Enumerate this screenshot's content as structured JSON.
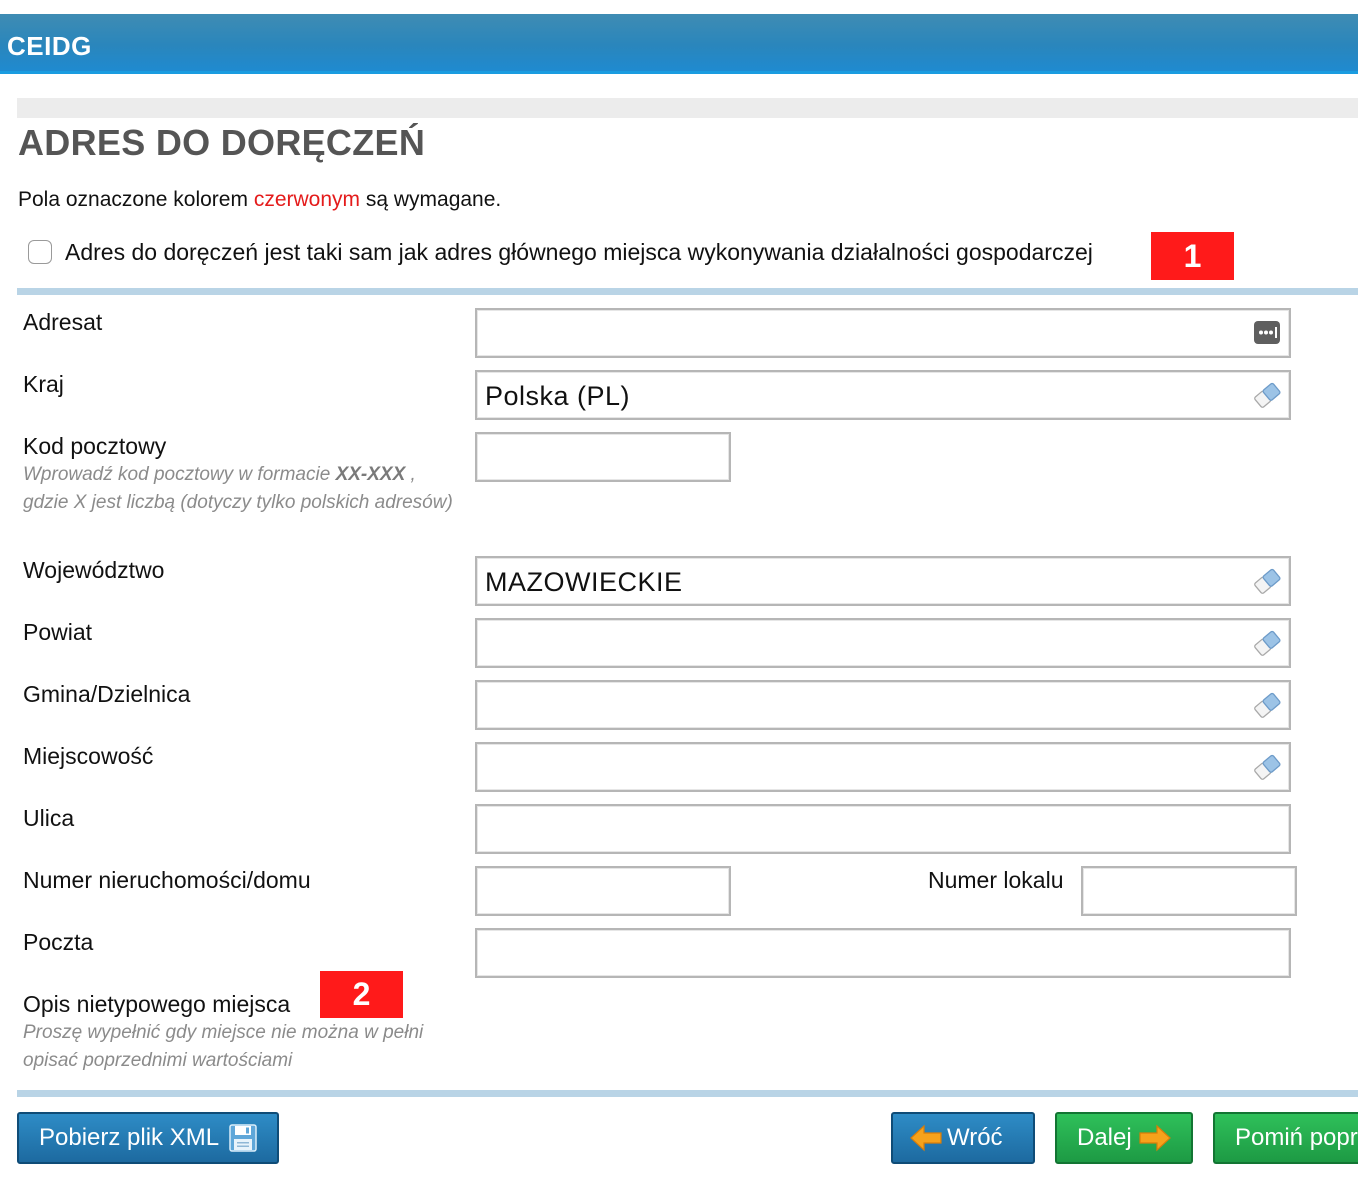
{
  "header": {
    "brand": "CEIDG"
  },
  "page": {
    "title": "ADRES DO DORĘCZEŃ",
    "required_note": {
      "prefix": "Pola oznaczone kolorem ",
      "highlight": "czerwonym",
      "suffix": " są wymagane."
    },
    "same_address_checkbox": {
      "label": "Adres do doręczeń jest taki sam jak adres głównego miejsca wykonywania działalności gospodarczej",
      "checked": false
    },
    "badges": [
      "1",
      "2"
    ]
  },
  "form": {
    "adresat": {
      "label": "Adresat",
      "value": "",
      "icon": "dots-menu-icon"
    },
    "kraj": {
      "label": "Kraj",
      "value": "Polska (PL)",
      "icon": "eraser-icon"
    },
    "kod_pocztowy": {
      "label": "Kod pocztowy",
      "hint_before": "Wprowadź kod pocztowy w formacie ",
      "hint_format": "XX-XXX",
      "hint_after": " , gdzie X jest liczbą (dotyczy tylko polskich adresów)",
      "value": ""
    },
    "wojewodztwo": {
      "label": "Województwo",
      "value": "MAZOWIECKIE",
      "icon": "eraser-icon"
    },
    "powiat": {
      "label": "Powiat",
      "value": "",
      "icon": "eraser-icon"
    },
    "gmina": {
      "label": "Gmina/Dzielnica",
      "value": "",
      "icon": "eraser-icon"
    },
    "miejscowosc": {
      "label": "Miejscowość",
      "value": "",
      "icon": "eraser-icon"
    },
    "ulica": {
      "label": "Ulica",
      "value": ""
    },
    "numer_domu": {
      "label": "Numer nieruchomości/domu",
      "value": ""
    },
    "numer_lokalu": {
      "label": "Numer lokalu",
      "value": ""
    },
    "poczta": {
      "label": "Poczta",
      "value": ""
    },
    "opis": {
      "label": "Opis nietypowego miejsca",
      "hint": "Proszę wypełnić gdy miejsce nie można w pełni opisać poprzednimi wartościami"
    }
  },
  "buttons": {
    "xml": {
      "label": "Pobierz plik XML",
      "icon": "floppy-disk-icon"
    },
    "back": {
      "label": "Wróć",
      "icon": "arrow-left-icon"
    },
    "next": {
      "label": "Dalej",
      "icon": "arrow-right-icon"
    },
    "skip": {
      "label": "Pomiń popr"
    }
  },
  "colors": {
    "header": "#2a86bc",
    "required": "#e41b1b",
    "badge": "#ff1a1a",
    "divider": "#b9d4e6",
    "button_blue": "#1d6aa0",
    "button_green": "#1d9a44"
  }
}
